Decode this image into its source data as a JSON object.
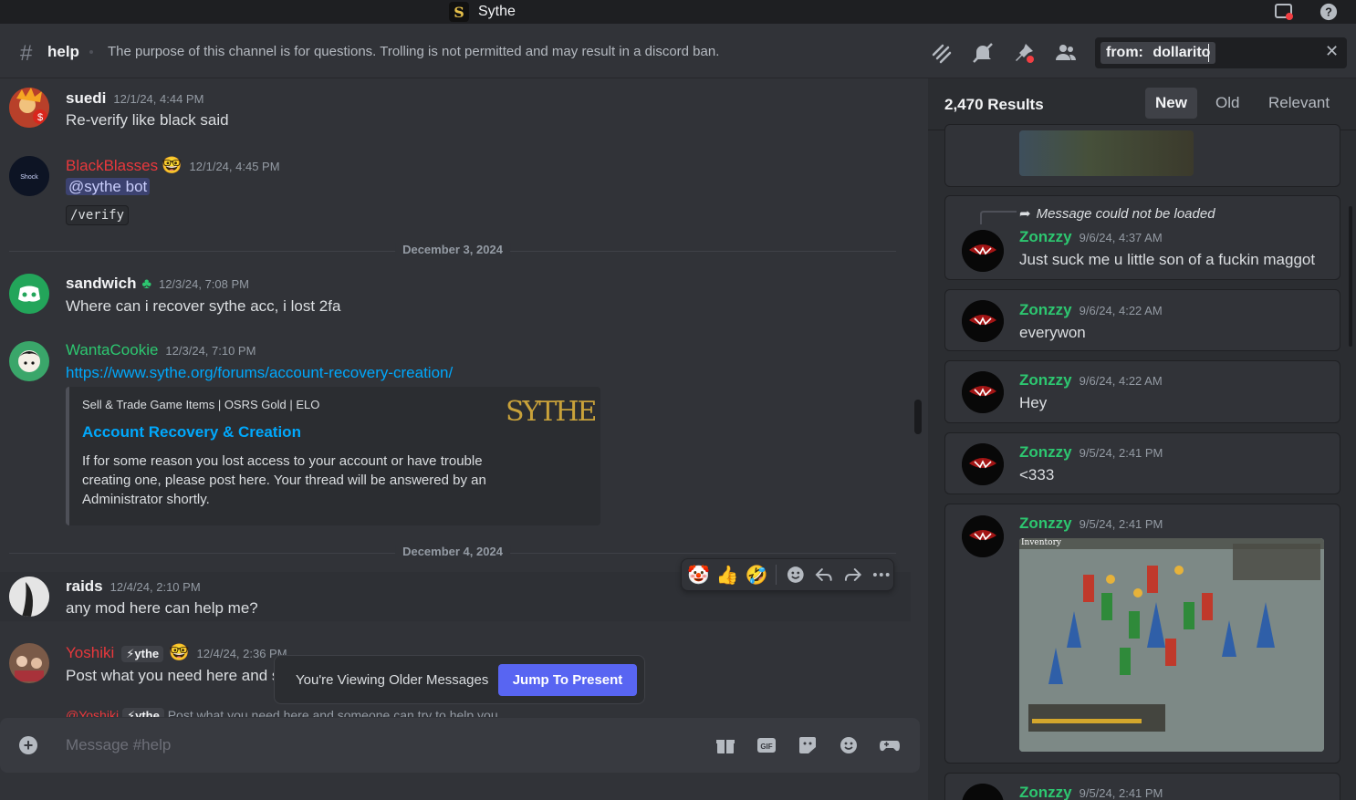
{
  "app": {
    "title": "Sythe",
    "logo_letter": "S"
  },
  "channel": {
    "name": "help",
    "topic": "The purpose of this channel is for questions. Trolling is not permitted and may result in a discord ban."
  },
  "search": {
    "filter_label": "from:",
    "filter_value": "dollarito"
  },
  "messages": [
    {
      "author": "suedi",
      "timestamp": "12/1/24, 4:44 PM",
      "text": "Re-verify like black said"
    },
    {
      "author": "BlackBlasses",
      "timestamp": "12/1/24, 4:45 PM",
      "mention": "@sythe bot",
      "code": "/verify"
    },
    {
      "author": "sandwich",
      "timestamp": "12/3/24, 7:08 PM",
      "text": "Where can i recover sythe acc, i lost 2fa"
    },
    {
      "author": "WantaCookie",
      "timestamp": "12/3/24, 7:10 PM",
      "link": "https://www.sythe.org/forums/account-recovery-creation/"
    },
    {
      "author": "raids",
      "timestamp": "12/4/24, 2:10 PM",
      "text": "any mod here can help me?"
    },
    {
      "author": "Yoshiki",
      "badge": "ythe",
      "timestamp": "12/4/24, 2:36 PM",
      "text": "Post what you need here and s"
    }
  ],
  "dividers": [
    "December 3, 2024",
    "December 4, 2024"
  ],
  "embed": {
    "provider": "Sell & Trade Game Items | OSRS Gold | ELO",
    "title": "Account Recovery & Creation",
    "description": "If for some reason you lost access to your account or have trouble creating one, please post here. Your thread will be answered by an Administrator shortly.",
    "thumb_text": "SYTHE"
  },
  "reply_preview": {
    "author": "@Yoshiki",
    "badge": "ythe",
    "text": "Post what you need here and someone can try to help you"
  },
  "older_bar": {
    "text": "You're Viewing Older Messages",
    "button": "Jump To Present"
  },
  "composer": {
    "placeholder": "Message #help"
  },
  "results": {
    "count": "2,470 Results",
    "sort_options": [
      "New",
      "Old",
      "Relevant"
    ],
    "active_sort": "New",
    "reply_notice": "Message could not be loaded",
    "items": [
      {
        "author": "Zonzzy",
        "timestamp": "9/6/24, 4:37 AM",
        "text": "Just suck me u little son of a fuckin maggot"
      },
      {
        "author": "Zonzzy",
        "timestamp": "9/6/24, 4:22 AM",
        "text": "everywon"
      },
      {
        "author": "Zonzzy",
        "timestamp": "9/6/24, 4:22 AM",
        "text": "Hey"
      },
      {
        "author": "Zonzzy",
        "timestamp": "9/5/24, 2:41 PM",
        "text": "<333"
      },
      {
        "author": "Zonzzy",
        "timestamp": "9/5/24, 2:41 PM",
        "image_caption": "Inventory"
      },
      {
        "author": "Zonzzy",
        "timestamp": "9/5/24, 2:41 PM"
      }
    ]
  },
  "colors": {
    "accent": "#5865f2",
    "link": "#00a8fc",
    "result_author": "#2dc770",
    "red_author": "#e8383c",
    "green_author": "#2dc770"
  }
}
